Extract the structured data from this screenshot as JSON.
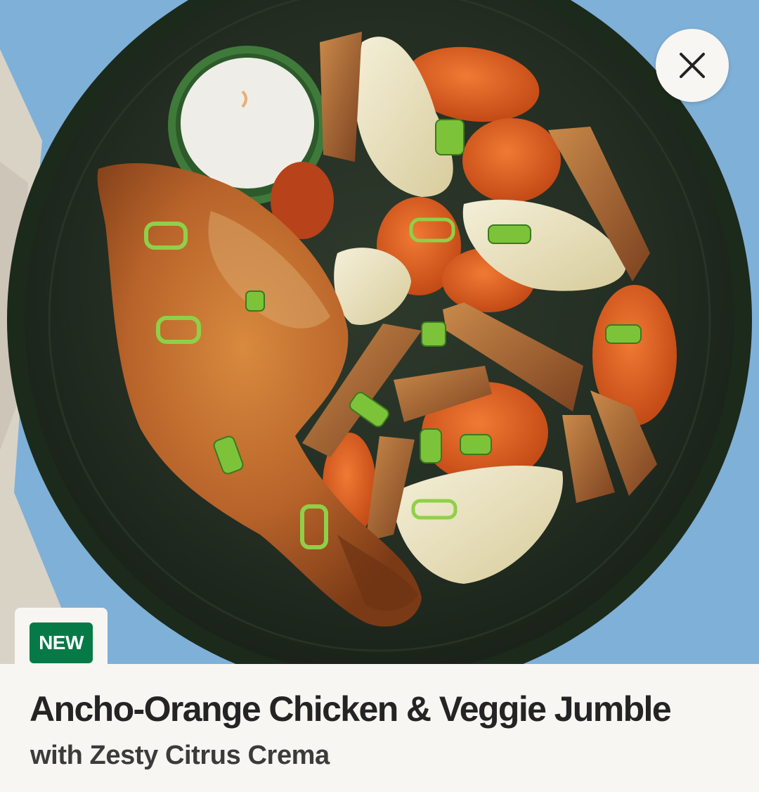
{
  "recipe": {
    "badge": "NEW",
    "title": "Ancho-Orange Chicken & Veggie Jumble",
    "subtitle": "with Zesty Citrus Crema"
  },
  "hero": {
    "image_subject": "roasted chicken leg with carrots, fennel, potato wedges, scallions and a cup of crema on a dark green plate"
  },
  "controls": {
    "close_icon": "close-icon"
  },
  "colors": {
    "badge_bg": "#067a46",
    "background": "#f7f6f2",
    "title_text": "#242424",
    "plate": "#1f2a1e",
    "tablecloth": "#7fb0d8"
  }
}
